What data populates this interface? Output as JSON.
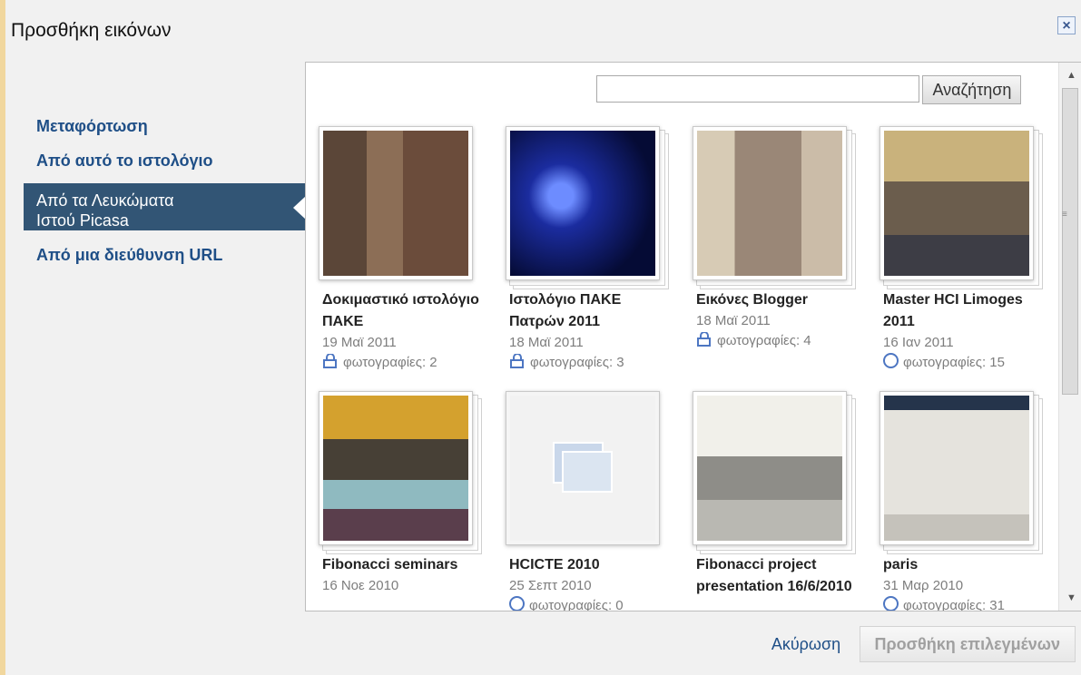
{
  "dialog": {
    "title": "Προσθήκη εικόνων",
    "close_symbol": "×"
  },
  "nav": {
    "items": [
      {
        "label": "Μεταφόρτωση"
      },
      {
        "label": "Από αυτό το ιστολόγιο"
      },
      {
        "label": "Από τα Λευκώματα\nΙστού Picasa",
        "selected": true
      },
      {
        "label": "Από μια διεύθυνση URL"
      }
    ]
  },
  "search": {
    "value": "",
    "button": "Αναζήτηση"
  },
  "albums": [
    {
      "name": "Δοκιμαστικό ιστολόγιο ΠΑΚΕ",
      "date": "19 Μαϊ 2011",
      "count": "φωτογραφίες: 2",
      "icon": "lock-icon"
    },
    {
      "name": "Ιστολόγιο ΠΑΚΕ Πατρών 2011",
      "date": "18 Μαϊ 2011",
      "count": "φωτογραφίες: 3",
      "icon": "lock-icon"
    },
    {
      "name": "Εικόνες Blogger",
      "date": "18 Μαϊ 2011",
      "count": "φωτογραφίες: 4",
      "icon": "lock-icon"
    },
    {
      "name": "Master HCI Limoges 2011",
      "date": "16 Ιαν 2011",
      "count": "φωτογραφίες: 15",
      "icon": "globe-icon"
    },
    {
      "name": "Fibonacci seminars",
      "date": "16 Νοε 2010",
      "count": "",
      "icon": ""
    },
    {
      "name": "HCICTE 2010",
      "date": "25 Σεπτ 2010",
      "count": "φωτογραφίες: 0",
      "icon": "globe-icon"
    },
    {
      "name": "Fibonacci project presentation 16/6/2010",
      "date": "",
      "count": "",
      "icon": ""
    },
    {
      "name": "paris",
      "date": "31 Μαρ 2010",
      "count": "φωτογραφίες: 31",
      "icon": "globe-icon"
    }
  ],
  "footer": {
    "cancel": "Ακύρωση",
    "add_selected": "Προσθήκη επιλεγμένων"
  }
}
